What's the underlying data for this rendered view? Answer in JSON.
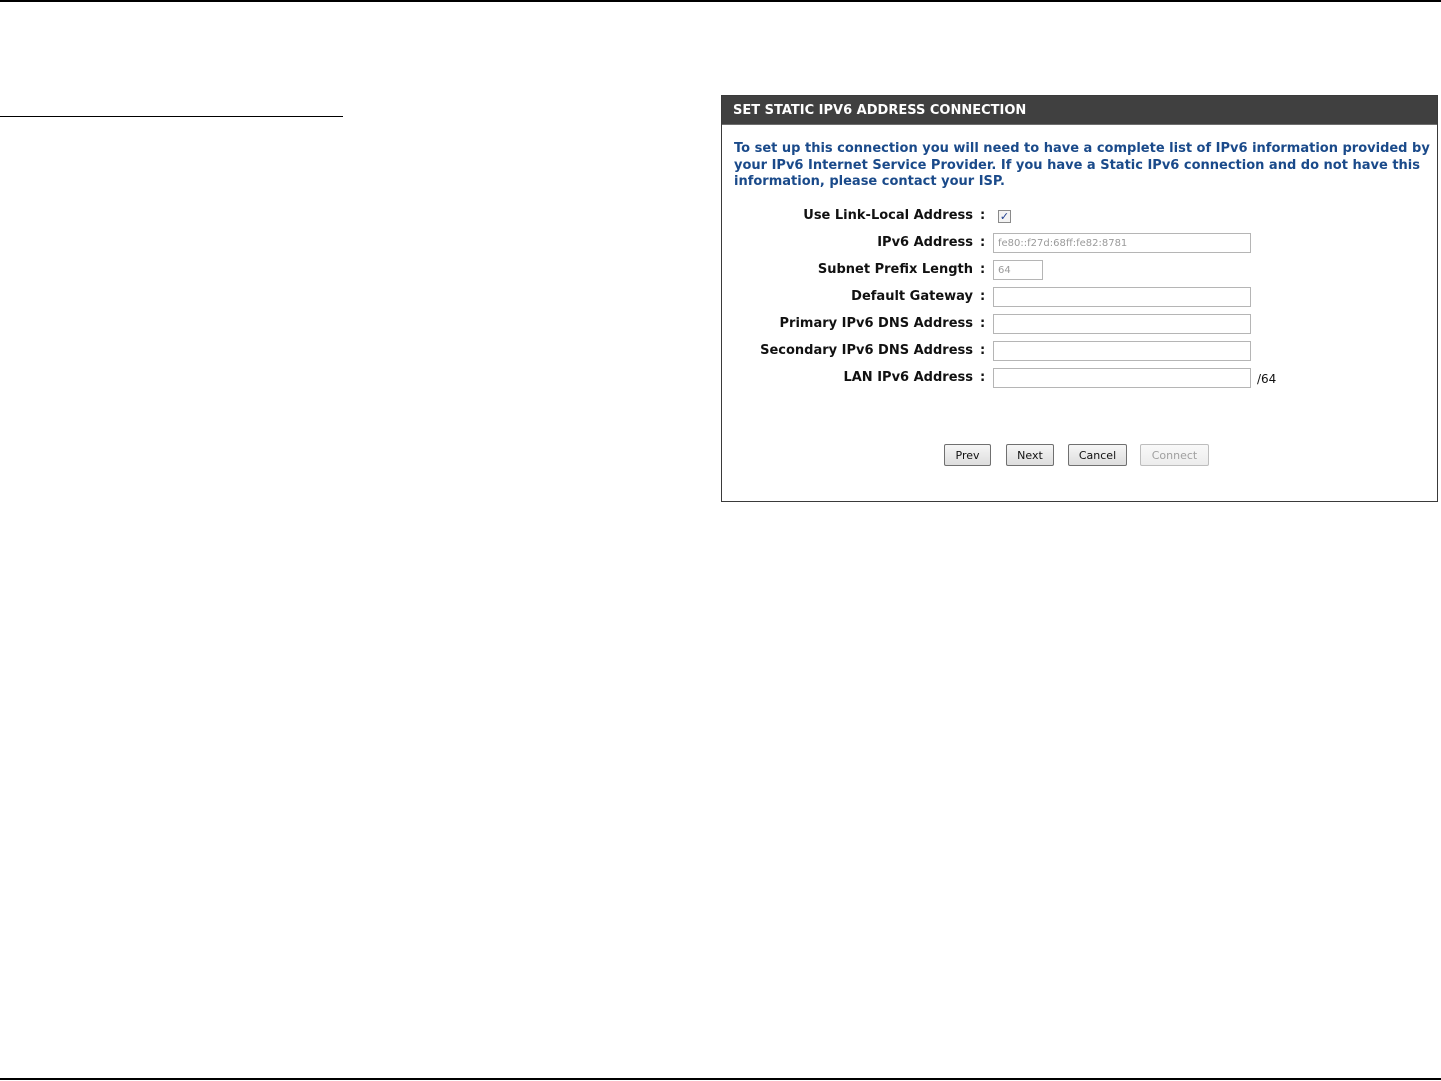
{
  "panel": {
    "title": "SET STATIC IPV6 ADDRESS CONNECTION",
    "intro": "To set up this connection you will need to have a complete list of IPv6 information provided by your IPv6 Internet Service Provider. If you have a Static IPv6 connection and do not have this information, please contact your ISP."
  },
  "form": {
    "colon": ":",
    "use_link_local": {
      "label": "Use Link-Local Address",
      "checked": true,
      "check_glyph": "✓"
    },
    "ipv6_address": {
      "label": "IPv6 Address",
      "value": "fe80::f27d:68ff:fe82:8781"
    },
    "subnet_prefix_length": {
      "label": "Subnet Prefix Length",
      "value": "64"
    },
    "default_gateway": {
      "label": "Default Gateway",
      "value": ""
    },
    "primary_dns": {
      "label": "Primary IPv6 DNS Address",
      "value": ""
    },
    "secondary_dns": {
      "label": "Secondary IPv6 DNS Address",
      "value": ""
    },
    "lan_ipv6_address": {
      "label": "LAN IPv6 Address",
      "value": "",
      "suffix": "/64"
    }
  },
  "buttons": {
    "prev": "Prev",
    "next": "Next",
    "cancel": "Cancel",
    "connect": "Connect"
  },
  "colors": {
    "header_bg": "#404040",
    "intro_text": "#1a4a8a"
  }
}
